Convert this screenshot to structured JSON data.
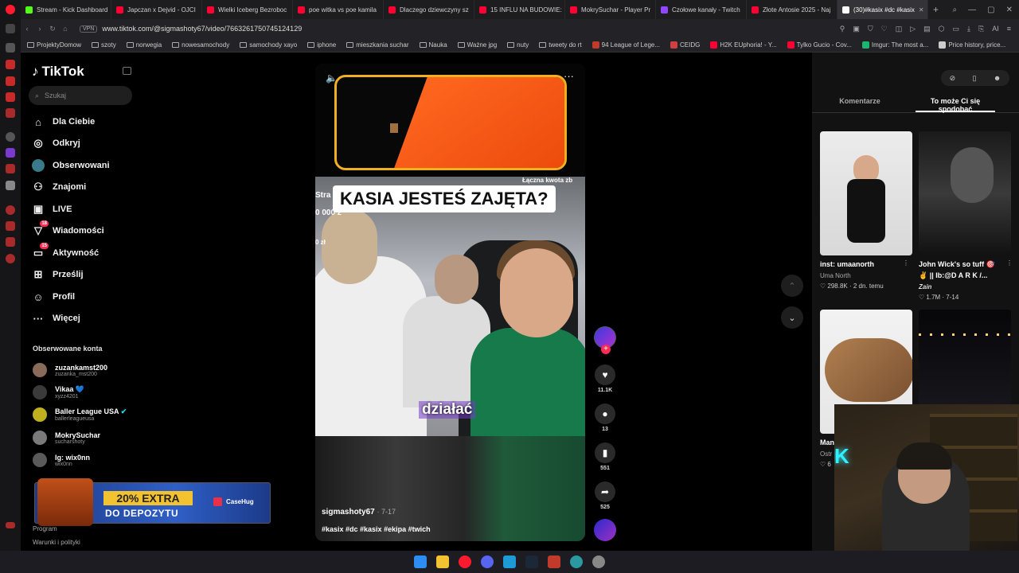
{
  "browser": {
    "tabs": [
      {
        "label": "Stream - Kick Dashboard",
        "color": "#53fc18"
      },
      {
        "label": "Japczan x Dejvid - OJCI",
        "color": "#ff0033"
      },
      {
        "label": "Wielki Iceberg Bezroboc",
        "color": "#ff0033"
      },
      {
        "label": "poe witka vs poe kamila",
        "color": "#ff0033"
      },
      {
        "label": "Dlaczego dziewczyny sz",
        "color": "#ff0033"
      },
      {
        "label": "15 INFLU NA BUDOWIE:",
        "color": "#ff0033"
      },
      {
        "label": "MokrySuchar - Player Pr",
        "color": "#ff0033"
      },
      {
        "label": "Czołowe kanały - Twitch",
        "color": "#9146ff"
      },
      {
        "label": "Złote Antosie 2025 - Naj",
        "color": "#ff0033"
      },
      {
        "label": "(30)#kasix #dc #kasix",
        "color": "#ffffff",
        "active": true
      }
    ],
    "vpn": "VPN",
    "url": "www.tiktok.com/@sigmashoty67/video/7663261750745124129",
    "ai_label": "AI",
    "bookmarks": [
      {
        "label": "ProjektyDomow",
        "kind": "folder"
      },
      {
        "label": "szoty",
        "kind": "folder"
      },
      {
        "label": "norwegia",
        "kind": "folder"
      },
      {
        "label": "nowesamochody",
        "kind": "folder"
      },
      {
        "label": "samochody xayo",
        "kind": "folder"
      },
      {
        "label": "iphone",
        "kind": "folder"
      },
      {
        "label": "mieszkania suchar",
        "kind": "folder"
      },
      {
        "label": "Nauka",
        "kind": "folder"
      },
      {
        "label": "Ważne jpg",
        "kind": "folder"
      },
      {
        "label": "nuty",
        "kind": "folder"
      },
      {
        "label": "tweety do rt",
        "kind": "folder"
      },
      {
        "label": "94 League of Lege...",
        "kind": "site",
        "color": "#c23a2a"
      },
      {
        "label": "CEIDG",
        "kind": "site",
        "color": "#d04040"
      },
      {
        "label": "H2K EUphoria! - Y...",
        "kind": "site",
        "color": "#ff0033"
      },
      {
        "label": "Tylko Gucio - Cov...",
        "kind": "site",
        "color": "#ff0033"
      },
      {
        "label": "Imgur: The most a...",
        "kind": "site",
        "color": "#1bb76e"
      },
      {
        "label": "Price history, price...",
        "kind": "site",
        "color": "#cccccc"
      }
    ]
  },
  "sidebar": {
    "logo": "TikTok",
    "search_placeholder": "Szukaj",
    "nav": [
      {
        "label": "Dla Ciebie",
        "icon": "home-icon",
        "glyph": "⌂"
      },
      {
        "label": "Odkryj",
        "icon": "compass-icon",
        "glyph": "◎"
      },
      {
        "label": "Obserwowani",
        "icon": "following-avatar-icon",
        "glyph": "●"
      },
      {
        "label": "Znajomi",
        "icon": "friends-icon",
        "glyph": "⚇"
      },
      {
        "label": "LIVE",
        "icon": "live-icon",
        "glyph": "▣"
      },
      {
        "label": "Wiadomości",
        "icon": "messages-icon",
        "glyph": "▽",
        "badge": "18"
      },
      {
        "label": "Aktywność",
        "icon": "activity-icon",
        "glyph": "▭",
        "badge": "15"
      },
      {
        "label": "Prześlij",
        "icon": "upload-icon",
        "glyph": "⊞"
      },
      {
        "label": "Profil",
        "icon": "profile-icon",
        "glyph": "☺"
      },
      {
        "label": "Więcej",
        "icon": "more-icon",
        "glyph": "···"
      }
    ],
    "followed_heading": "Obserwowane konta",
    "followed": [
      {
        "name": "zuzankamst200",
        "handle": "zuzanka_mst200"
      },
      {
        "name": "Vikaa 💙",
        "handle": "xyzz4201"
      },
      {
        "name": "Baller League USA",
        "handle": "ballerleagueusa",
        "verified": true
      },
      {
        "name": "MokrySuchar",
        "handle": "sucharshoty"
      },
      {
        "name": "Ig: wix0nn",
        "handle": "wix0nn"
      }
    ],
    "footer_links": [
      "Program",
      "Warunki i polityki"
    ]
  },
  "promo": {
    "line1": "20% EXTRA",
    "line2": "DO DEPOZYTU",
    "brand": "CaseHug"
  },
  "video": {
    "caption_overlay": "KASIA JESTEŚ ZAJĘTA?",
    "subtitle": "działać",
    "overlay_left_1": "Stra",
    "overlay_left_2": "0 000 z",
    "overlay_left_3": "0 zł",
    "overlay_right_1": "Łączna kwota zb",
    "overlay_right_2": "arbonk",
    "author": "sigmashoty67",
    "date": "· 7-17",
    "hashtags": "#kasix #dc #kasix #ekipa #twich",
    "actions": {
      "likes": "11.1K",
      "comments": "13",
      "saves": "551",
      "shares": "525"
    }
  },
  "right_panel": {
    "tabs": [
      "Komentarze",
      "To może Ci się spodobać"
    ],
    "active_tab": 1,
    "tools": [
      "⊘",
      "▯",
      "☻"
    ],
    "cards": [
      {
        "title": "inst: umaanorth",
        "user": "Uma North",
        "stats": "♡ 298.8K · 2 dn. temu"
      },
      {
        "title": "John Wick's so tuff 🎯",
        "subtitle": "✌ || Ib:@D A R K /...",
        "user": "Zain",
        "stats": "♡ 1.7M · 7-14"
      },
      {
        "title": "Man",
        "user": "Ostr",
        "stats": "♡ 6"
      }
    ]
  }
}
